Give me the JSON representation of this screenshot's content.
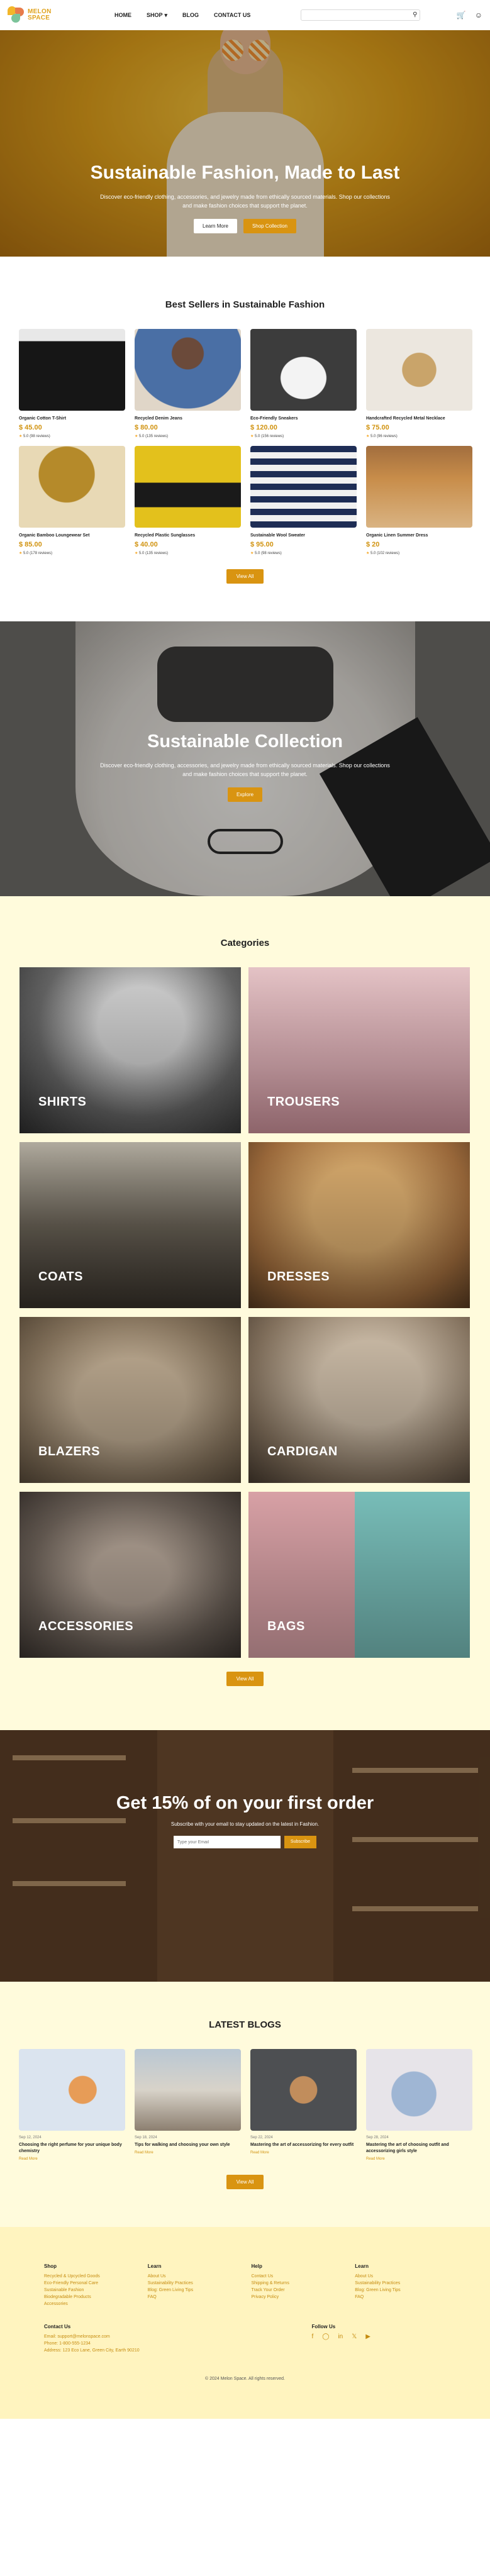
{
  "brand": {
    "line1": "MELON",
    "line2": "SPACE"
  },
  "nav": {
    "home": "HOME",
    "shop": "SHOP",
    "blog": "BLOG",
    "contact": "CONTACT US"
  },
  "search": {
    "placeholder": ""
  },
  "hero": {
    "title": "Sustainable Fashion, Made to Last",
    "text": "Discover eco-friendly clothing, accessories, and jewelry made from ethically sourced materials. Shop our collections and make fashion choices that support the planet.",
    "learn_more": "Learn More",
    "shop_collection": "Shop Collection"
  },
  "best_sellers": {
    "title": "Best Sellers in Sustainable Fashion",
    "view_all": "View All",
    "products": [
      {
        "name": "Organic Cotton T-Shirt",
        "price": "$ 45.00",
        "rating": "5.0",
        "reviews": "(98 reviews)"
      },
      {
        "name": "Recycled Denim Jeans",
        "price": "$ 80.00",
        "rating": "5.0",
        "reviews": "(135 reviews)"
      },
      {
        "name": "Eco-Friendly Sneakers",
        "price": "$ 120.00",
        "rating": "5.0",
        "reviews": "(156 reviews)"
      },
      {
        "name": "Handcrafted Recycled Metal Necklace",
        "price": "$ 75.00",
        "rating": "5.0",
        "reviews": "(96 reviews)"
      },
      {
        "name": "Organic Bamboo Loungewear Set",
        "price": "$ 85.00",
        "rating": "5.0",
        "reviews": "(178 reviews)"
      },
      {
        "name": "Recycled Plastic Sunglasses",
        "price": "$ 40.00",
        "rating": "5.0",
        "reviews": "(135 reviews)"
      },
      {
        "name": "Sustainable Wool Sweater",
        "price": "$ 95.00",
        "rating": "5.0",
        "reviews": "(98 reviews)"
      },
      {
        "name": "Organic Linen Summer Dress",
        "price": "$ 20",
        "rating": "5.0",
        "reviews": "(102 reviews)"
      }
    ]
  },
  "collection": {
    "title": "Sustainable Collection",
    "text": "Discover eco-friendly clothing, accessories, and jewelry made from ethically sourced materials. Shop our collections and make fashion choices that support the planet.",
    "explore": "Explore"
  },
  "categories": {
    "title": "Categories",
    "view_all": "View All",
    "items": [
      "SHIRTS",
      "TROUSERS",
      "COATS",
      "DRESSES",
      "BLAZERS",
      "CARDIGAN",
      "ACCESSORIES",
      "BAGS"
    ]
  },
  "promo": {
    "title": "Get 15% of on your first order",
    "text": "Subscribe with your email to stay updated on the latest in Fashion.",
    "email_placeholder": "Type your Email",
    "button": "Subscribe"
  },
  "blogs": {
    "title": "LATEST BLOGS",
    "view_all": "View All",
    "items": [
      {
        "date": "Sep 12, 2024",
        "title": "Choosing the right perfume for your unique body chemistry",
        "more": "Read More"
      },
      {
        "date": "Sep 18, 2024",
        "title": "Tips for walking and choosing your own style",
        "more": "Read More"
      },
      {
        "date": "Sep 22, 2024",
        "title": "Mastering the art of accessorizing for every outfit",
        "more": "Read More"
      },
      {
        "date": "Sep 28, 2024",
        "title": "Mastering the art of choosing outfit and accessorizing girls style",
        "more": "Read More"
      }
    ]
  },
  "footer": {
    "cols": [
      {
        "head": "Shop",
        "links": [
          "Recycled & Upcycled Goods",
          "Eco-Friendly Personal Care",
          "Sustainable Fashion",
          "Biodegradable Products",
          "Accessories"
        ]
      },
      {
        "head": "Learn",
        "links": [
          "About Us",
          "Sustainability Practices",
          "Blog: Green Living Tips",
          "FAQ"
        ]
      },
      {
        "head": "Help",
        "links": [
          "Contact Us",
          "Shipping & Returns",
          "Track Your Order",
          "Privacy Policy"
        ]
      },
      {
        "head": "Learn",
        "links": [
          "About Us",
          "Sustainability Practices",
          "Blog: Green Living Tips",
          "FAQ"
        ]
      }
    ],
    "contact_head": "Contact Us",
    "email": "Email: support@melonspace.com",
    "phone": "Phone: 1-800-555-1234",
    "address": "Address: 123 Eco Lane, Green City, Earth 90210",
    "follow_head": "Follow Us",
    "copyright": "© 2024 Melon Space. All rights reserved."
  }
}
